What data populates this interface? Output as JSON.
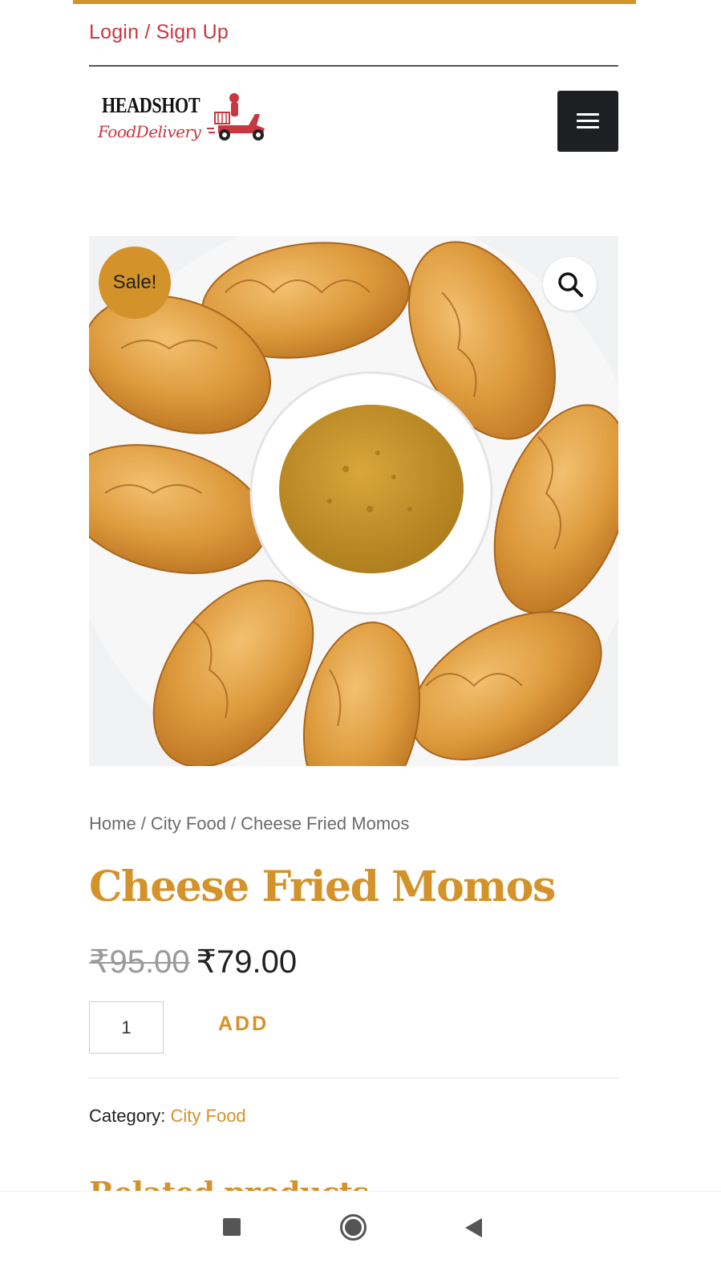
{
  "header": {
    "login_label": "Login / Sign Up",
    "logo_title": "HEADSHOT",
    "logo_subtitle": "FoodDelivery",
    "menu_icon": "hamburger-menu-icon"
  },
  "product": {
    "sale_badge": "Sale!",
    "zoom_icon": "search-icon",
    "breadcrumb": [
      "Home",
      "City Food",
      "Cheese Fried Momos"
    ],
    "breadcrumb_separator": "/",
    "title": "Cheese Fried Momos",
    "price_old": "₹95.00",
    "price_new": "₹79.00",
    "quantity": "1",
    "add_label": "ADD",
    "category_label": "Category:",
    "category_value": "City Food"
  },
  "related": {
    "heading": "Related products"
  },
  "system_nav": {
    "recents_icon": "square-icon",
    "home_icon": "circle-home-icon",
    "back_icon": "triangle-back-icon"
  },
  "colors": {
    "accent": "#d4922a",
    "login": "#c8373f",
    "dark": "#1e1f22"
  }
}
